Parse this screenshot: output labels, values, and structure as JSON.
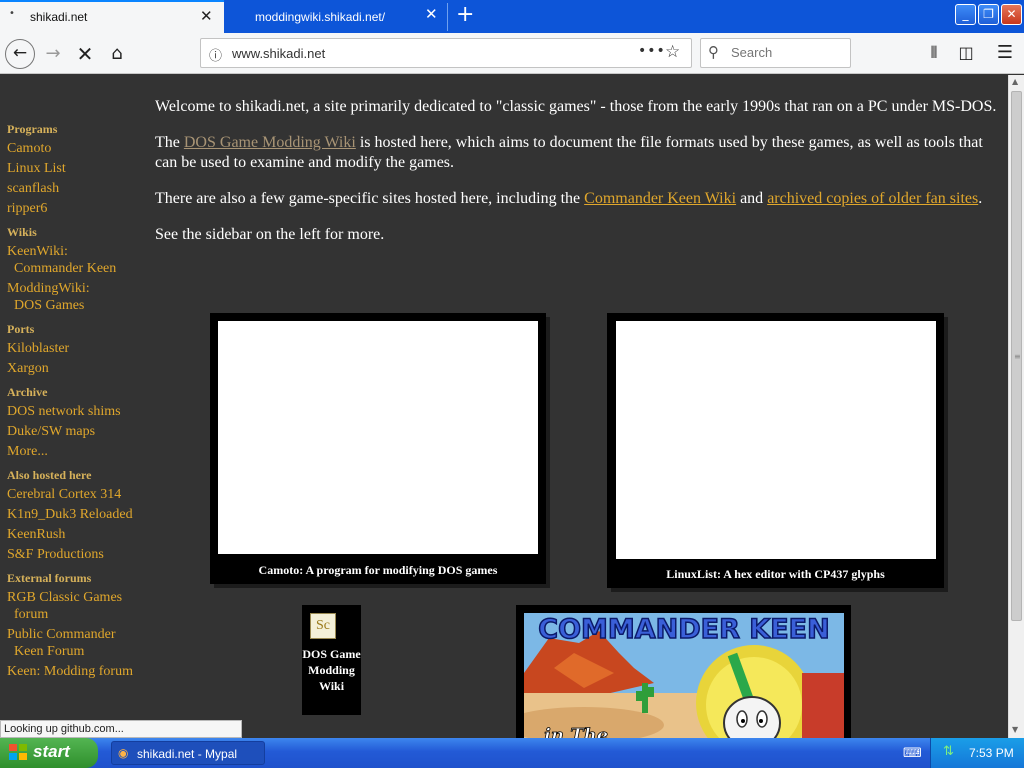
{
  "browser": {
    "tabs": [
      {
        "title": "shikadi.net",
        "active": true
      },
      {
        "title": "moddingwiki.shikadi.net/",
        "active": false
      }
    ],
    "new_tab_label": "+",
    "url": "www.shikadi.net",
    "search_placeholder": "Search",
    "status_text": "Looking up github.com..."
  },
  "sidebar": {
    "sections": [
      {
        "heading": "Programs",
        "links": [
          [
            "Camoto"
          ],
          [
            "Linux List"
          ],
          [
            "scanflash"
          ],
          [
            "ripper6"
          ]
        ]
      },
      {
        "heading": "Wikis",
        "links": [
          [
            "KeenWiki:",
            "Commander Keen"
          ],
          [
            "ModdingWiki:",
            "DOS Games"
          ]
        ]
      },
      {
        "heading": "Ports",
        "links": [
          [
            "Kiloblaster"
          ],
          [
            "Xargon"
          ]
        ]
      },
      {
        "heading": "Archive",
        "links": [
          [
            "DOS network shims"
          ],
          [
            "Duke/SW maps"
          ],
          [
            "More..."
          ]
        ]
      },
      {
        "heading": "Also hosted here",
        "links": [
          [
            "Cerebral Cortex 314"
          ],
          [
            "K1n9_Duk3 Reloaded"
          ],
          [
            "KeenRush"
          ],
          [
            "S&F Productions"
          ]
        ]
      },
      {
        "heading": "External forums",
        "links": [
          [
            "RGB Classic Games",
            "forum"
          ],
          [
            "Public Commander",
            "Keen Forum"
          ],
          [
            "Keen: Modding forum"
          ]
        ]
      }
    ]
  },
  "main": {
    "p1": "Welcome to shikadi.net, a site primarily dedicated to \"classic games\" - those from the early 1990s that ran on a PC under MS-DOS.",
    "p2_before": "The ",
    "p2_link": "DOS Game Modding Wiki",
    "p2_after": " is hosted here, which aims to document the file formats used by these games, as well as tools that can be used to examine and modify the games.",
    "p3_before": "There are also a few game-specific sites hosted here, including the ",
    "p3_link1": "Commander Keen Wiki",
    "p3_mid": " and ",
    "p3_link2": "archived copies of older fan sites",
    "p3_after": ".",
    "p4": "See the sidebar on the left for more.",
    "cards": {
      "camoto_caption": "Camoto: A program for modifying DOS games",
      "linuxlist_caption": "LinuxList: A hex editor with CP437 glyphs",
      "wiki_logo_text": "Sc",
      "wiki_caption": "DOS Game Modding Wiki",
      "keen_title": "COMMANDER KEEN",
      "keen_sub": "in The"
    }
  },
  "taskbar": {
    "start_label": "start",
    "task_label": "shikadi.net - Mypal",
    "clock": "7:53 PM"
  },
  "colors": {
    "page_bg": "#333333",
    "link": "#e0a72c",
    "visited_link": "#a89475",
    "taskbar": "#235ad6"
  }
}
